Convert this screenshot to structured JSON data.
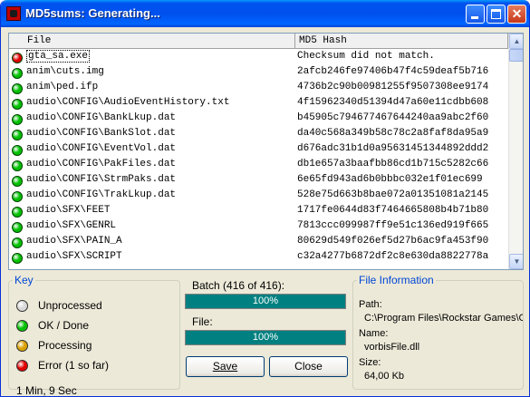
{
  "window": {
    "title": "MD5sums: Generating..."
  },
  "list": {
    "columns": {
      "file": "File",
      "md5": "MD5 Hash"
    },
    "rows": [
      {
        "file": "gta_sa.exe",
        "hash": "Checksum did not match.",
        "status": "error",
        "selected": true
      },
      {
        "file": "anim\\cuts.img",
        "hash": "2afcb246fe97406b47f4c59deaf5b716",
        "status": "ok"
      },
      {
        "file": "anim\\ped.ifp",
        "hash": "4736b2c90b00981255f9507308ee9174",
        "status": "ok"
      },
      {
        "file": "audio\\CONFIG\\AudioEventHistory.txt",
        "hash": "4f15962340d51394d47a60e11cdbb608",
        "status": "ok"
      },
      {
        "file": "audio\\CONFIG\\BankLkup.dat",
        "hash": "b45905c794677467644240aa9abc2f60",
        "status": "ok"
      },
      {
        "file": "audio\\CONFIG\\BankSlot.dat",
        "hash": "da40c568a349b58c78c2a8faf8da95a9",
        "status": "ok"
      },
      {
        "file": "audio\\CONFIG\\EventVol.dat",
        "hash": "d676adc31b1d0a95631451344892ddd2",
        "status": "ok"
      },
      {
        "file": "audio\\CONFIG\\PakFiles.dat",
        "hash": "db1e657a3baafbb86cd1b715c5282c66",
        "status": "ok"
      },
      {
        "file": "audio\\CONFIG\\StrmPaks.dat",
        "hash": "6e65fd943ad6b0bbbc032e1f01ec699",
        "status": "ok"
      },
      {
        "file": "audio\\CONFIG\\TrakLkup.dat",
        "hash": "528e75d663b8bae072a01351081a2145",
        "status": "ok"
      },
      {
        "file": "audio\\SFX\\FEET",
        "hash": "1717fe0644d83f7464665808b4b71b80",
        "status": "ok"
      },
      {
        "file": "audio\\SFX\\GENRL",
        "hash": "7813ccc099987ff9e51c136ed919f665",
        "status": "ok"
      },
      {
        "file": "audio\\SFX\\PAIN_A",
        "hash": "80629d549f026ef5d27b6ac9fa453f90",
        "status": "ok"
      },
      {
        "file": "audio\\SFX\\SCRIPT",
        "hash": "c32a4277b6872df2c8e630da8822778a",
        "status": "ok"
      }
    ]
  },
  "colors": {
    "ok": "#00c000",
    "error": "#e00000",
    "processing": "#d8a000",
    "unprocessed": "#d8d8d8",
    "progress": "#008080"
  },
  "key": {
    "legend": "Key",
    "items": [
      {
        "label": "Unprocessed",
        "status": "unprocessed"
      },
      {
        "label": "OK / Done",
        "status": "ok"
      },
      {
        "label": "Processing",
        "status": "processing"
      },
      {
        "label": "Error  (1 so far)",
        "status": "error"
      }
    ],
    "elapsed": "1 Min, 9 Sec"
  },
  "progress": {
    "batch_label": "Batch (416 of 416):",
    "batch_percent": 100,
    "batch_text": "100%",
    "file_label": "File:",
    "file_percent": 100,
    "file_text": "100%"
  },
  "buttons": {
    "save": "Save",
    "close": "Close"
  },
  "file_info": {
    "legend": "File Information",
    "path_label": "Path:",
    "path_value": "C:\\Program Files\\Rockstar Games\\G",
    "name_label": "Name:",
    "name_value": "vorbisFile.dll",
    "size_label": "Size:",
    "size_value": "64,00 Kb"
  }
}
